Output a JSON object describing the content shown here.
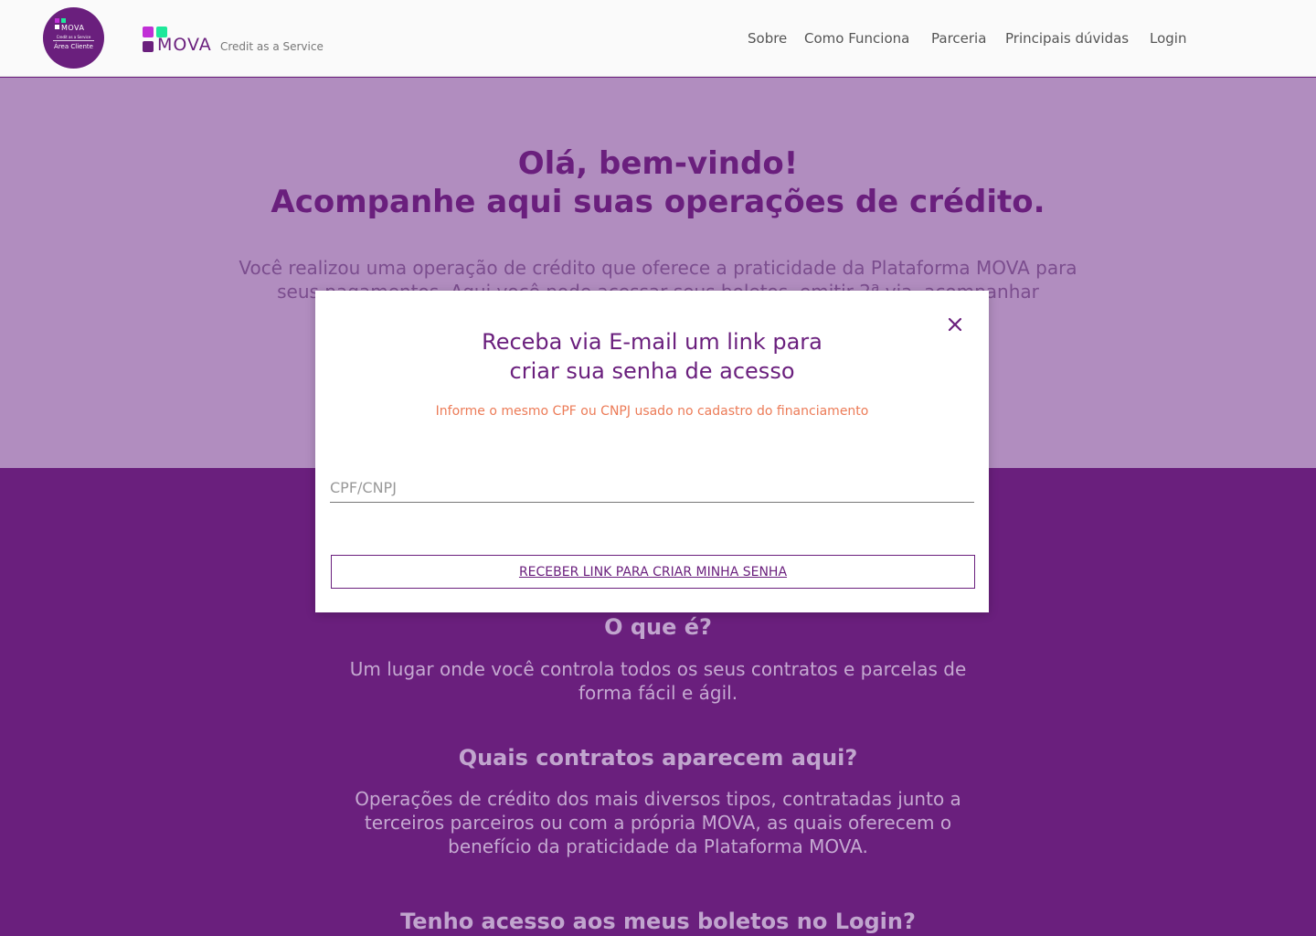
{
  "header": {
    "badge": {
      "brand": "MOVA",
      "tagline": "Credit as a Service",
      "area": "Área Cliente"
    },
    "logo": {
      "brand": "MOVA",
      "tagline": "Credit as a Service"
    },
    "nav": [
      "Sobre",
      "Como Funciona",
      "Parceria",
      "Principais dúvidas",
      "Login"
    ]
  },
  "hero": {
    "title_line1": "Olá, bem-vindo!",
    "title_line2": "Acompanhe aqui suas operações de crédito.",
    "text": "Você realizou uma operação de crédito que oferece a praticidade da Plataforma MOVA para seus pagamentos. Aqui você pode acessar seus boletos, emitir 2ª via, acompanhar"
  },
  "sections": [
    {
      "heading": "O que é?",
      "text": "Um lugar onde você controla todos os seus contratos e parcelas de forma fácil e ágil."
    },
    {
      "heading": "Quais contratos aparecem aqui?",
      "text": "Operações de crédito dos mais diversos tipos, contratadas junto a terceiros parceiros ou com a própria MOVA, as quais oferecem o benefício da praticidade da Plataforma MOVA."
    },
    {
      "heading": "Tenho acesso aos meus boletos no Login?",
      "text": ""
    }
  ],
  "modal": {
    "title_line1": "Receba via E-mail um link para",
    "title_line2": "criar sua senha de acesso",
    "hint": "Informe o mesmo CPF ou CNPJ usado no cadastro do financiamento",
    "input_placeholder": "CPF/CNPJ",
    "input_value": "",
    "button_label": "RECEBER LINK PARA CRIAR MINHA SENHA",
    "close_icon": "close-icon"
  },
  "colors": {
    "brand_purple": "#6a1f7d",
    "hero_bg": "#b18dbf",
    "accent_pink": "#c12fd6",
    "accent_green": "#1ee89a",
    "hint_orange": "#ec7b57"
  }
}
